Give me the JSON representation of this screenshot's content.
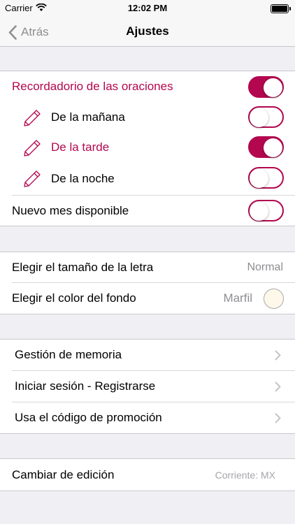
{
  "status_bar": {
    "carrier": "Carrier",
    "time": "12:02 PM"
  },
  "nav": {
    "back_label": "Atrás",
    "title": "Ajustes"
  },
  "reminders": {
    "main_label": "Recordadorio de las oraciones",
    "main_on": true,
    "items": [
      {
        "label": "De la mañana",
        "on": false,
        "icon": "pencil-icon"
      },
      {
        "label": "De la tarde",
        "on": true,
        "icon": "pencil-icon"
      },
      {
        "label": "De la noche",
        "on": false,
        "icon": "pencil-icon"
      }
    ],
    "new_month_label": "Nuevo mes disponible",
    "new_month_on": false
  },
  "appearance": {
    "font_size_label": "Elegir el tamaño de la letra",
    "font_size_value": "Normal",
    "background_label": "Elegir el color del fondo",
    "background_value": "Marfil",
    "background_color": "#fdf8ea"
  },
  "account": {
    "items": [
      {
        "label": "Gestión de memoria"
      },
      {
        "label": "Iniciar sesión - Registrarse"
      },
      {
        "label": "Usa el código de promoción"
      }
    ]
  },
  "edition": {
    "label": "Cambiar de edición",
    "value": "Corriente: MX"
  },
  "colors": {
    "accent": "#b3074f",
    "background": "#efeff4",
    "secondary_text": "#8e8e93"
  }
}
